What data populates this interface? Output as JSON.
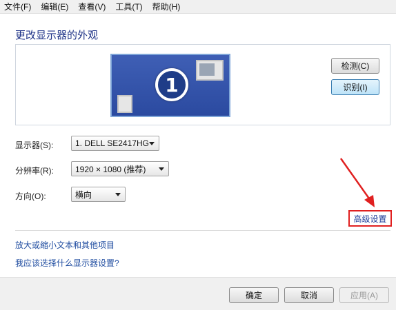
{
  "menubar": {
    "items": [
      "文件(F)",
      "编辑(E)",
      "查看(V)",
      "工具(T)",
      "帮助(H)"
    ]
  },
  "page": {
    "title": "更改显示器的外观"
  },
  "preview": {
    "monitor_number": "1",
    "detect_label": "检测(C)",
    "identify_label": "识别(I)"
  },
  "form": {
    "display_label": "显示器(S):",
    "display_value": "1. DELL SE2417HG",
    "resolution_label": "分辨率(R):",
    "resolution_value": "1920 × 1080 (推荐)",
    "orientation_label": "方向(O):",
    "orientation_value": "横向"
  },
  "advanced": {
    "label": "高级设置"
  },
  "links": {
    "text_size": "放大或缩小文本和其他项目",
    "which_settings": "我应该选择什么显示器设置?"
  },
  "footer": {
    "ok_label": "确定",
    "cancel_label": "取消",
    "apply_label": "应用(A)"
  },
  "colors": {
    "title": "#1e3287",
    "link": "#1f4ca0",
    "highlight_border": "#e02020",
    "monitor_blue": "#2b4aa0"
  }
}
